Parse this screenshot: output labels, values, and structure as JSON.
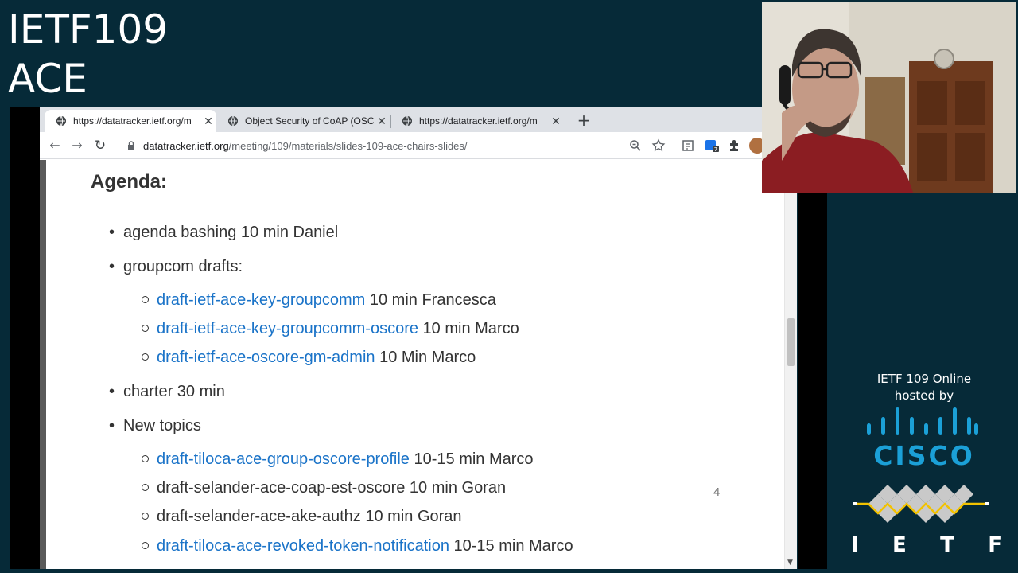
{
  "session": {
    "line1": "IETF109",
    "line2": "ACE"
  },
  "browser": {
    "tabs": [
      {
        "title": "https://datatracker.ietf.org/m",
        "icon": "globe-icon",
        "active": true
      },
      {
        "title": "Object Security of CoAP (OSCO",
        "icon": "globe-icon",
        "active": false
      },
      {
        "title": "https://datatracker.ietf.org/m",
        "icon": "globe-icon",
        "active": false
      }
    ],
    "url_host": "datatracker.ietf.org",
    "url_path": "/meeting/109/materials/slides-109-ace-chairs-slides/"
  },
  "slide": {
    "heading": "Agenda:",
    "items": [
      {
        "text": "agenda bashing 10 min Daniel"
      },
      {
        "text": "groupcom drafts:"
      },
      {
        "link": "draft-ietf-ace-key-groupcomm",
        "rest": " 10 min Francesca"
      },
      {
        "link": "draft-ietf-ace-key-groupcomm-oscore",
        "rest": " 10 min Marco"
      },
      {
        "link": "draft-ietf-ace-oscore-gm-admin",
        "rest": " 10 Min Marco"
      },
      {
        "text": "charter 30 min"
      },
      {
        "text": "New topics"
      },
      {
        "link": "draft-tiloca-ace-group-oscore-profile",
        "rest": " 10-15 min Marco"
      },
      {
        "text": "draft-selander-ace-coap-est-oscore 10 min Goran"
      },
      {
        "text": "draft-selander-ace-ake-authz 10 min Goran"
      },
      {
        "link": "draft-tiloca-ace-revoked-token-notification",
        "rest": " 10-15 min Marco"
      }
    ],
    "page_number": "4"
  },
  "sponsor": {
    "line1": "IETF 109 Online",
    "line2": "hosted by",
    "cisco": "CISCO",
    "ietf_letters": [
      "I",
      "E",
      "T",
      "F"
    ]
  },
  "colors": {
    "background": "#062a38",
    "link": "#1a73c8",
    "cisco_blue": "#1ba0d7",
    "ietf_yellow": "#f2c200"
  }
}
